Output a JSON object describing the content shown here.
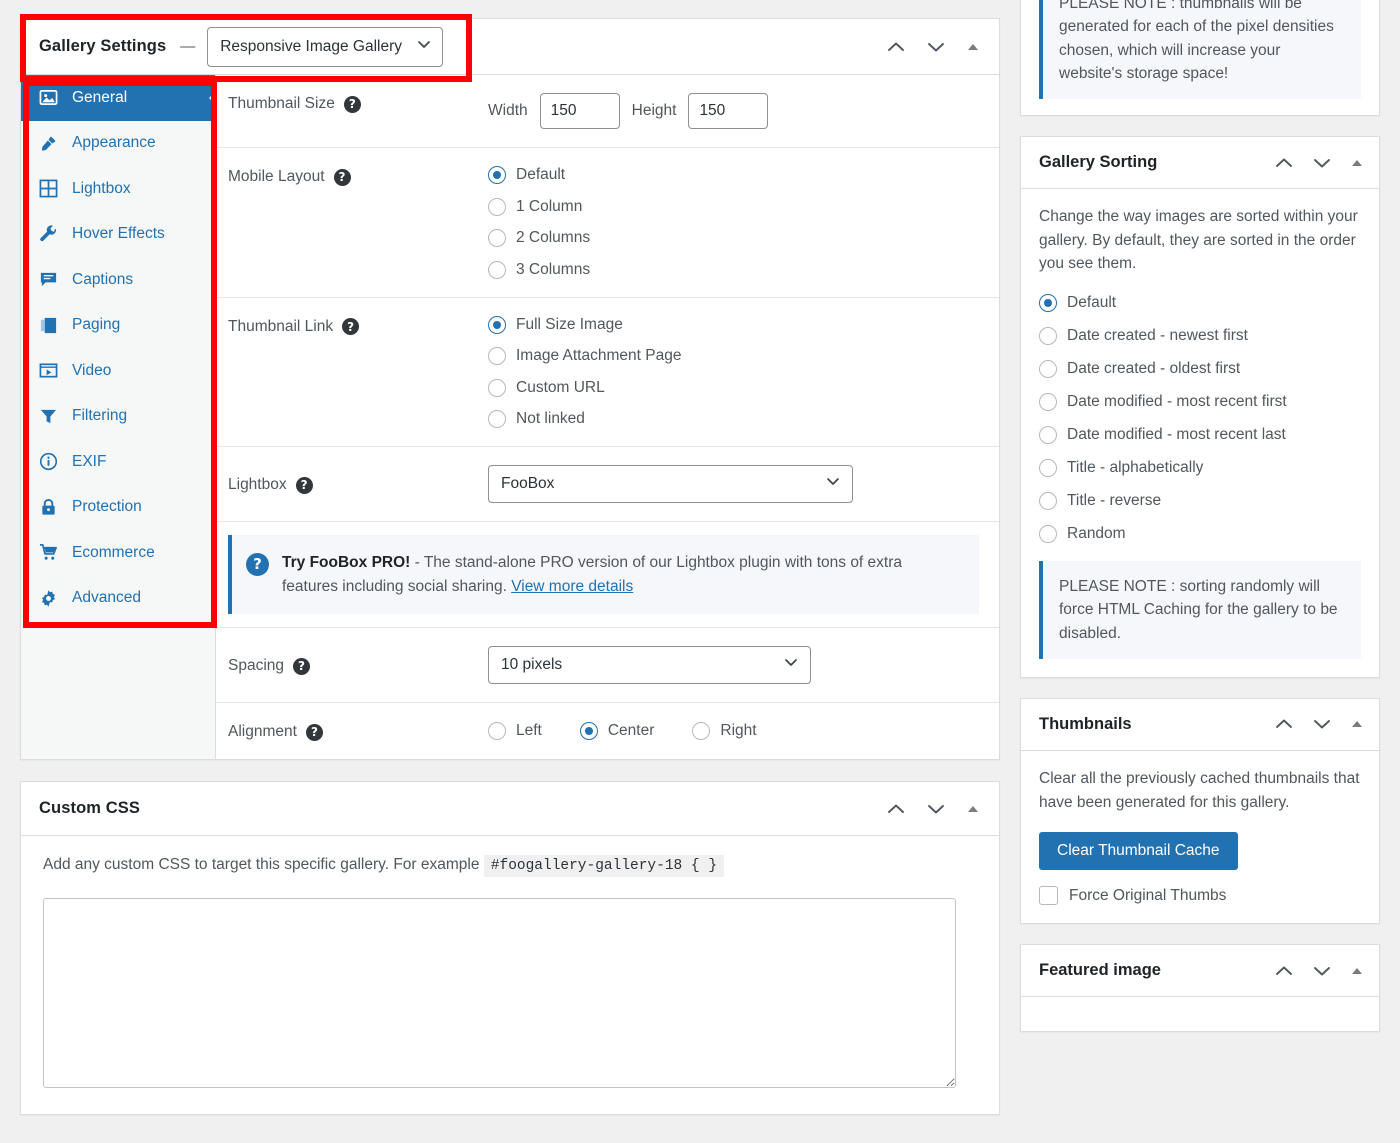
{
  "gallery_settings": {
    "title": "Gallery Settings",
    "separator": "—",
    "type_value": "Responsive Image Gallery",
    "tabs": [
      {
        "label": "General",
        "icon": "image-icon",
        "active": true
      },
      {
        "label": "Appearance",
        "icon": "brush-icon",
        "active": false
      },
      {
        "label": "Lightbox",
        "icon": "grid-icon",
        "active": false
      },
      {
        "label": "Hover Effects",
        "icon": "wrench-icon",
        "active": false
      },
      {
        "label": "Captions",
        "icon": "comment-icon",
        "active": false
      },
      {
        "label": "Paging",
        "icon": "book-icon",
        "active": false
      },
      {
        "label": "Video",
        "icon": "video-icon",
        "active": false
      },
      {
        "label": "Filtering",
        "icon": "funnel-icon",
        "active": false
      },
      {
        "label": "EXIF",
        "icon": "info-icon",
        "active": false
      },
      {
        "label": "Protection",
        "icon": "lock-icon",
        "active": false
      },
      {
        "label": "Ecommerce",
        "icon": "cart-icon",
        "active": false
      },
      {
        "label": "Advanced",
        "icon": "gear-icon",
        "active": false
      }
    ],
    "thumbnail_size": {
      "label": "Thumbnail Size",
      "width_label": "Width",
      "width_value": "150",
      "height_label": "Height",
      "height_value": "150"
    },
    "mobile_layout": {
      "label": "Mobile Layout",
      "options": [
        "Default",
        "1 Column",
        "2 Columns",
        "3 Columns"
      ],
      "selected": "Default"
    },
    "thumbnail_link": {
      "label": "Thumbnail Link",
      "options": [
        "Full Size Image",
        "Image Attachment Page",
        "Custom URL",
        "Not linked"
      ],
      "selected": "Full Size Image"
    },
    "lightbox": {
      "label": "Lightbox",
      "value": "FooBox"
    },
    "foobox_notice": {
      "strong": "Try FooBox PRO!",
      "text": " - The stand-alone PRO version of our Lightbox plugin with tons of extra features including social sharing. ",
      "link": "View more details"
    },
    "spacing": {
      "label": "Spacing",
      "value": "10 pixels"
    },
    "alignment": {
      "label": "Alignment",
      "options": [
        "Left",
        "Center",
        "Right"
      ],
      "selected": "Center"
    }
  },
  "custom_css": {
    "title": "Custom CSS",
    "description_before": "Add any custom CSS to target this specific gallery. For example",
    "code_example": "#foogallery-gallery-18 { }",
    "textarea_value": "",
    "textarea_placeholder": ""
  },
  "sidebar": {
    "thumbnail_note": "PLEASE NOTE : thumbnails will be generated for each of the pixel densities chosen, which will increase your website's storage space!",
    "gallery_sorting": {
      "title": "Gallery Sorting",
      "description": "Change the way images are sorted within your gallery. By default, they are sorted in the order you see them.",
      "options": [
        "Default",
        "Date created - newest first",
        "Date created - oldest first",
        "Date modified - most recent first",
        "Date modified - most recent last",
        "Title - alphabetically",
        "Title - reverse",
        "Random"
      ],
      "selected": "Default",
      "note": "PLEASE NOTE : sorting randomly will force HTML Caching for the gallery to be disabled."
    },
    "thumbnails": {
      "title": "Thumbnails",
      "description": "Clear all the previously cached thumbnails that have been generated for this gallery.",
      "button_label": "Clear Thumbnail Cache",
      "checkbox_label": "Force Original Thumbs",
      "checkbox_checked": false
    },
    "featured_image": {
      "title": "Featured image"
    }
  },
  "colors": {
    "accent_blue": "#2271b1",
    "annotation_red": "#ff0000",
    "panel_border": "#dcdcde",
    "page_bg": "#f0f0f1",
    "notice_bg": "#f6f7fb"
  },
  "panel_icons": {
    "move_up": "chevron-up-icon",
    "move_down": "chevron-down-icon",
    "collapse": "caret-up-icon"
  }
}
